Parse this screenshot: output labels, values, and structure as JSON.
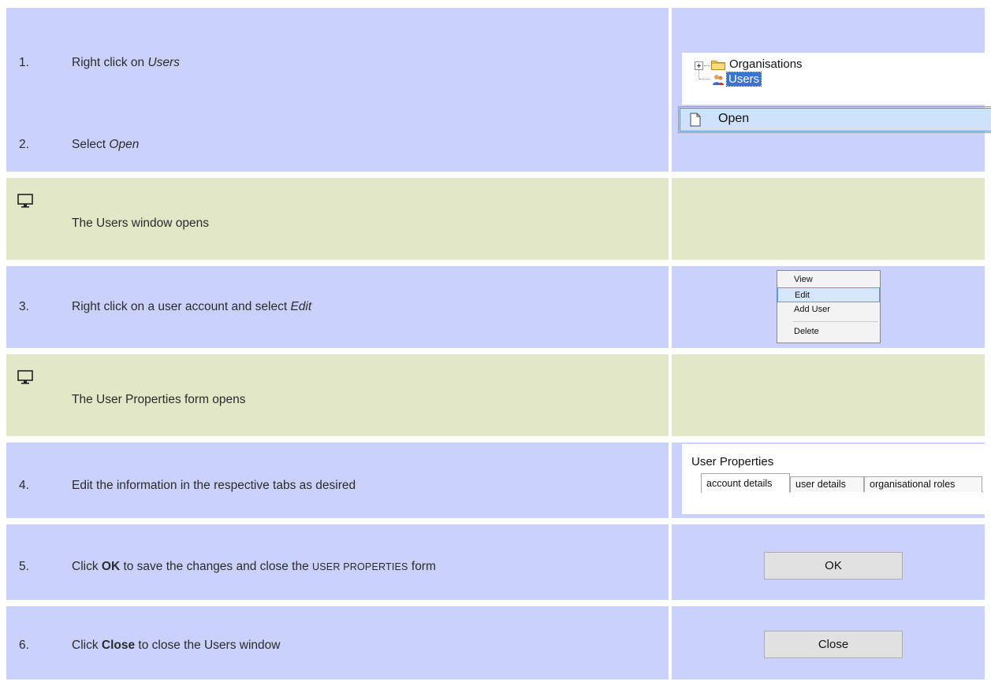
{
  "steps": {
    "s1": {
      "num": "1.",
      "text": "Right click on ",
      "em": "Users"
    },
    "s2": {
      "num": "2.",
      "text": "Select ",
      "em": "Open"
    },
    "i1": {
      "text": "The Users window opens"
    },
    "s3": {
      "num": "3.",
      "text": "Right click on a user account and select ",
      "em": "Edit"
    },
    "i2": {
      "text": "The User Properties form opens"
    },
    "s4": {
      "num": "4.",
      "text": "Edit the information in the respective tabs as desired"
    },
    "s5": {
      "num": "5.",
      "pre": "Click ",
      "bold": "OK",
      "mid": " to save the changes and close the ",
      "caps": "USER PROPERTIES",
      "post": " form"
    },
    "s6": {
      "num": "6.",
      "pre": "Click ",
      "bold": "Close",
      "post": " to close the Users window"
    }
  },
  "tree": {
    "item1": "Organisations",
    "item2": "Users"
  },
  "open_menu": {
    "label": "Open"
  },
  "context_menu": {
    "items": [
      "View",
      "Edit",
      "Add User",
      "Delete"
    ],
    "highlighted": "Edit"
  },
  "user_properties": {
    "title": "User Properties",
    "tabs": [
      "account details",
      "user details",
      "organisational roles"
    ]
  },
  "buttons": {
    "ok": "OK",
    "close": "Close"
  },
  "icons": {
    "info": "monitor-icon"
  },
  "colors": {
    "step_bg": "#cad2fb",
    "info_bg": "#e2e7c8",
    "selection": "#3b73d1"
  }
}
